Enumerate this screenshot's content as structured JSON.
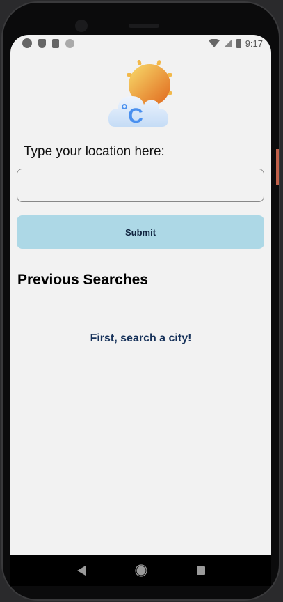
{
  "status_bar": {
    "time": "9:17",
    "left_icons": [
      "expo-icon",
      "play-protect-icon",
      "sd-card-icon",
      "dot-icon"
    ],
    "right_icons": [
      "wifi-icon",
      "signal-icon",
      "battery-icon"
    ]
  },
  "app": {
    "logo": "weather-sun-cloud-celsius-icon",
    "logo_text": "°C",
    "location_label": "Type your location here:",
    "location_input": {
      "value": "",
      "placeholder": ""
    },
    "submit_label": "Submit",
    "submit_color": "#add8e6",
    "previous_title": "Previous Searches",
    "empty_message": "First, search a city!"
  },
  "nav_bar": {
    "buttons": [
      "back-icon",
      "home-icon",
      "recents-icon"
    ]
  }
}
